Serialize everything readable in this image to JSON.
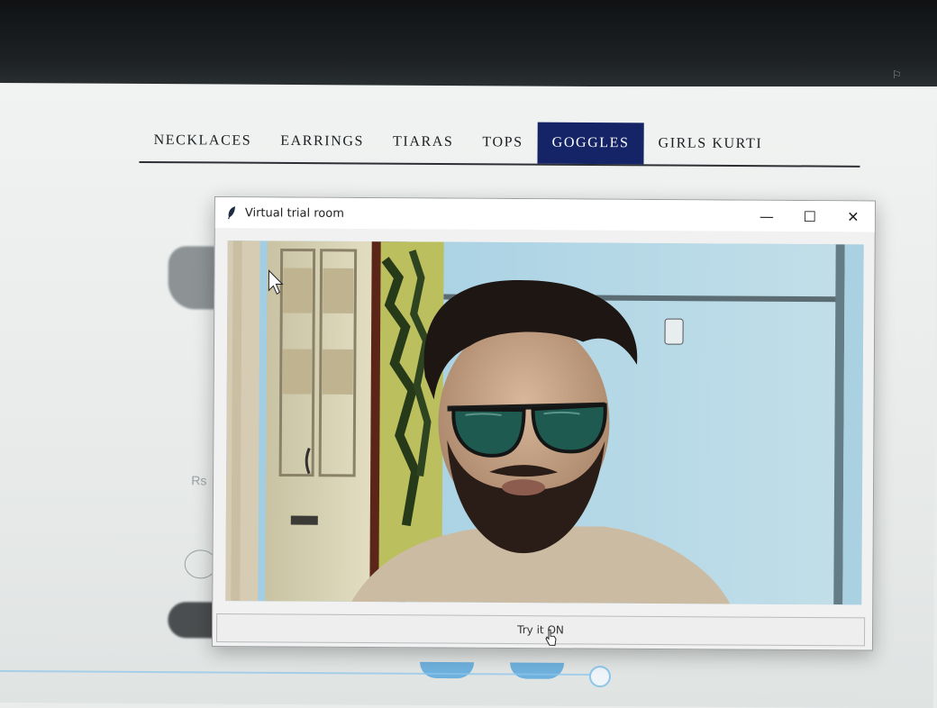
{
  "nav": {
    "items": [
      "NECKLACES",
      "EARRINGS",
      "TIARAS",
      "TOPS",
      "GOGGLES",
      "GIRLS KURTI"
    ],
    "active": "GOGGLES"
  },
  "background": {
    "price_fragment": "Rs"
  },
  "window": {
    "title": "Virtual trial room",
    "minimize": "—",
    "maximize": "☐",
    "close": "✕",
    "try_button": "Try it ON"
  },
  "colors": {
    "nav_active_bg": "#142466",
    "video_wall": "#a7cfe2"
  }
}
